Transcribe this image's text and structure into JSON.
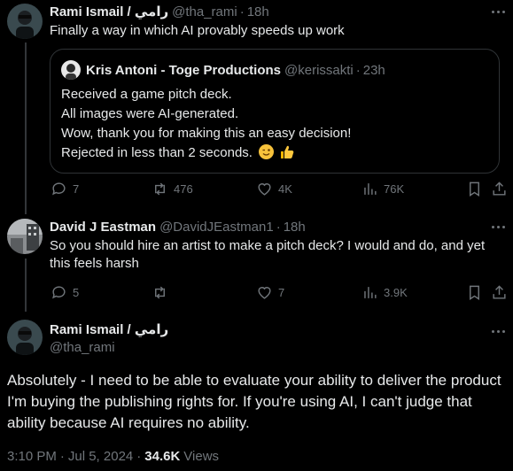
{
  "tweet1": {
    "name": "Rami Ismail / رامي",
    "handle": "@tha_rami",
    "sep": "·",
    "time": "18h",
    "text": "Finally a way in which AI provably speeds up work",
    "quote": {
      "name": "Kris Antoni - Toge Productions",
      "handle": "@kerissakti",
      "sep": "·",
      "time": "23h",
      "lines": [
        "Received a game pitch deck.",
        "All images were AI-generated.",
        "Wow, thank you for making this an easy decision!",
        "Rejected in less than 2 seconds."
      ],
      "emojis": [
        "winking-face-emoji",
        "thumbs-up-emoji"
      ]
    },
    "actions": {
      "replies": "7",
      "reposts": "476",
      "likes": "4K",
      "views": "76K"
    }
  },
  "tweet2": {
    "name": "David J Eastman",
    "handle": "@DavidJEastman1",
    "sep": "·",
    "time": "18h",
    "text": "So you should hire an artist to make a pitch deck? I would and do, and yet this feels harsh",
    "actions": {
      "replies": "5",
      "reposts": "",
      "likes": "7",
      "views": "3.9K"
    }
  },
  "tweet3": {
    "name": "Rami Ismail / رامي",
    "handle": "@tha_rami",
    "text": "Absolutely - I need to be able to evaluate your ability to deliver the product I'm buying the publishing rights for. If you're using AI, I can't judge that ability because AI requires no ability.",
    "time": "3:10 PM",
    "date": "Jul 5, 2024",
    "views_count": "34.6K",
    "views_label": "Views"
  },
  "colors": {
    "background": "#000000",
    "text": "#e7e9ea",
    "muted": "#71767b",
    "border": "#2f3336"
  }
}
